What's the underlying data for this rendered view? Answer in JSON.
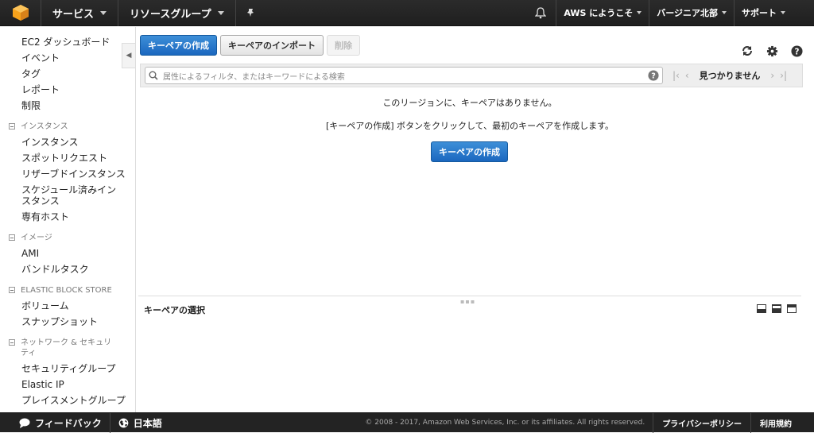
{
  "topnav": {
    "logo_icon": "aws-cube-icon",
    "services_label": "サービス",
    "resource_groups_label": "リソースグループ",
    "pin_icon": "pin-icon",
    "bell_icon": "bell-icon",
    "account_label": "AWS にようこそ",
    "region_label": "バージニア北部",
    "support_label": "サポート"
  },
  "sidebar": {
    "top_items": [
      "EC2 ダッシュボード",
      "イベント",
      "タグ",
      "レポート",
      "制限"
    ],
    "sections": [
      {
        "title": "インスタンス",
        "items": [
          "インスタンス",
          "スポットリクエスト",
          "リザーブドインスタンス",
          "スケジュール済みインスタンス",
          "専有ホスト"
        ]
      },
      {
        "title": "イメージ",
        "items": [
          "AMI",
          "バンドルタスク"
        ]
      },
      {
        "title": "ELASTIC BLOCK STORE",
        "items": [
          "ボリューム",
          "スナップショット"
        ]
      },
      {
        "title": "ネットワーク & セキュリティ",
        "items": [
          "セキュリティグループ",
          "Elastic IP",
          "プレイスメントグループ"
        ]
      }
    ]
  },
  "toolbar": {
    "create_label": "キーペアの作成",
    "import_label": "キーペアのインポート",
    "delete_label": "削除"
  },
  "filter": {
    "placeholder": "属性によるフィルタ、またはキーワードによる検索",
    "not_found_label": "見つかりません"
  },
  "empty": {
    "message": "このリージョンに、キーペアはありません。",
    "hint": "[キーペアの作成] ボタンをクリックして、最初のキーペアを作成します。",
    "create_label": "キーペアの作成"
  },
  "detail": {
    "title": "キーペアの選択"
  },
  "footer": {
    "feedback_label": "フィードバック",
    "language_label": "日本語",
    "copyright": "© 2008 - 2017, Amazon Web Services, Inc. or its affiliates. All rights reserved.",
    "privacy_label": "プライバシーポリシー",
    "terms_label": "利用規約"
  },
  "colors": {
    "primary_button": "#1b67bf",
    "topbar_bg": "#232323",
    "logo_orange": "#f7a21b"
  }
}
